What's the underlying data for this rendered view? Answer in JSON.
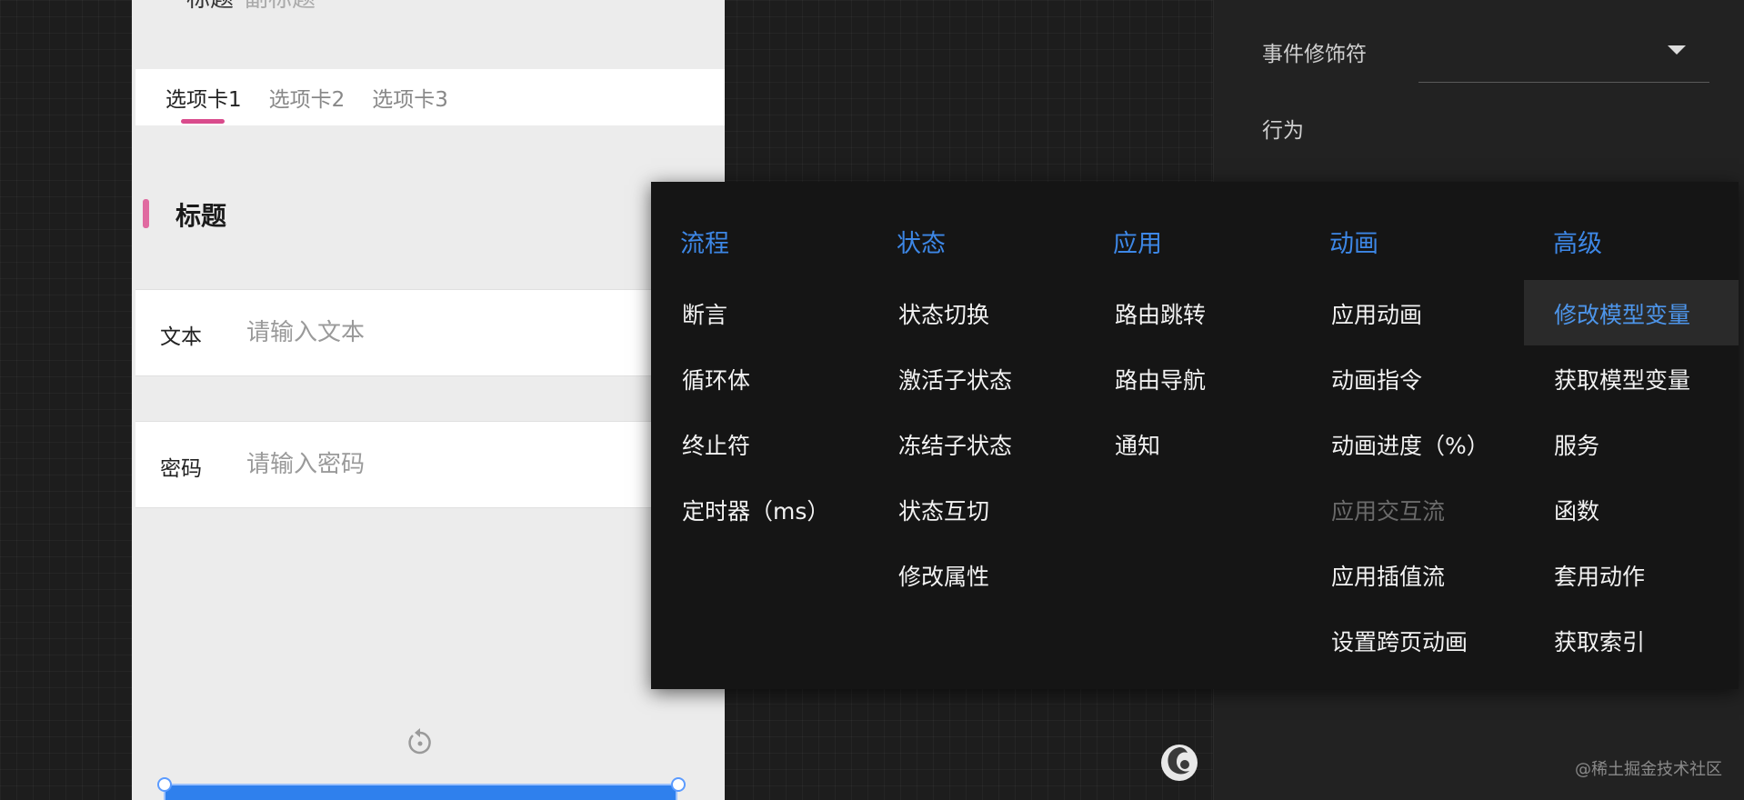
{
  "phone": {
    "top_title": "标题",
    "top_subtitle": "副标题",
    "tabs": [
      "选项卡1",
      "选项卡2",
      "选项卡3"
    ],
    "section_title": "标题",
    "fields": [
      {
        "label": "文本",
        "placeholder": "请输入文本"
      },
      {
        "label": "密码",
        "placeholder": "请输入密码"
      }
    ]
  },
  "right_panel": {
    "event_modifier_label": "事件修饰符",
    "behavior_label": "行为"
  },
  "menu": {
    "columns": [
      {
        "header": "流程",
        "items": [
          "断言",
          "循环体",
          "终止符",
          "定时器（ms）"
        ]
      },
      {
        "header": "状态",
        "items": [
          "状态切换",
          "激活子状态",
          "冻结子状态",
          "状态互切",
          "修改属性"
        ]
      },
      {
        "header": "应用",
        "items": [
          "路由跳转",
          "路由导航",
          "通知"
        ]
      },
      {
        "header": "动画",
        "items": [
          "应用动画",
          "动画指令",
          "动画进度（%）",
          "应用交互流",
          "应用插值流",
          "设置跨页动画"
        ]
      },
      {
        "header": "高级",
        "items": [
          "修改模型变量",
          "获取模型变量",
          "服务",
          "函数",
          "套用动作",
          "获取索引"
        ]
      }
    ],
    "disabled_item": "应用交互流",
    "highlighted_item": "修改模型变量"
  },
  "colors": {
    "accent_blue": "#3d87e6",
    "tab_indicator": "#d94b8c",
    "menu_bg": "#151515"
  },
  "watermark": "@稀土掘金技术社区"
}
